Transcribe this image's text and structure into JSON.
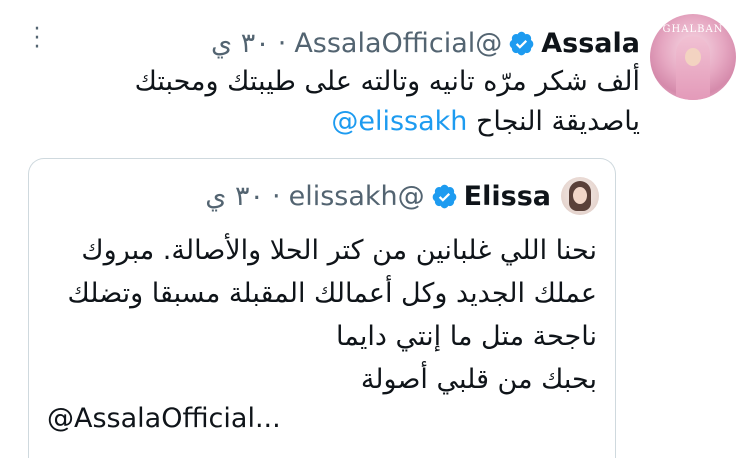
{
  "colors": {
    "accent": "#1d9bf0",
    "text": "#0f1419",
    "secondary": "#536471",
    "border": "#cfd9de"
  },
  "tweet": {
    "avatar_brand": "GHALBAN",
    "name": "Assala",
    "handle": "@AssalaOfficial",
    "separator": "·",
    "time": "٣٠ ي",
    "text_line1": "ألف شكر مرّه تانيه وتالته على طيبتك ومحبتك",
    "text_line2": "ياصديقة النجاح",
    "mention": "@elissakh",
    "more_icon": "more-icon",
    "verified_icon": "verified-badge-icon"
  },
  "quote": {
    "name": "Elissa",
    "handle": "@elissakh",
    "separator": "·",
    "time": "٣٠ ي",
    "lines": [
      "نحنا اللي غلبانين من كتر الحلا والأصالة. مبروك",
      "عملك الجديد وكل أعمالك المقبلة مسبقا وتضلك",
      "ناجحة متل ما إنتي دايما",
      "بحبك من قلبي أصولة"
    ],
    "truncated_mention": "@AssalaOfficial..."
  }
}
